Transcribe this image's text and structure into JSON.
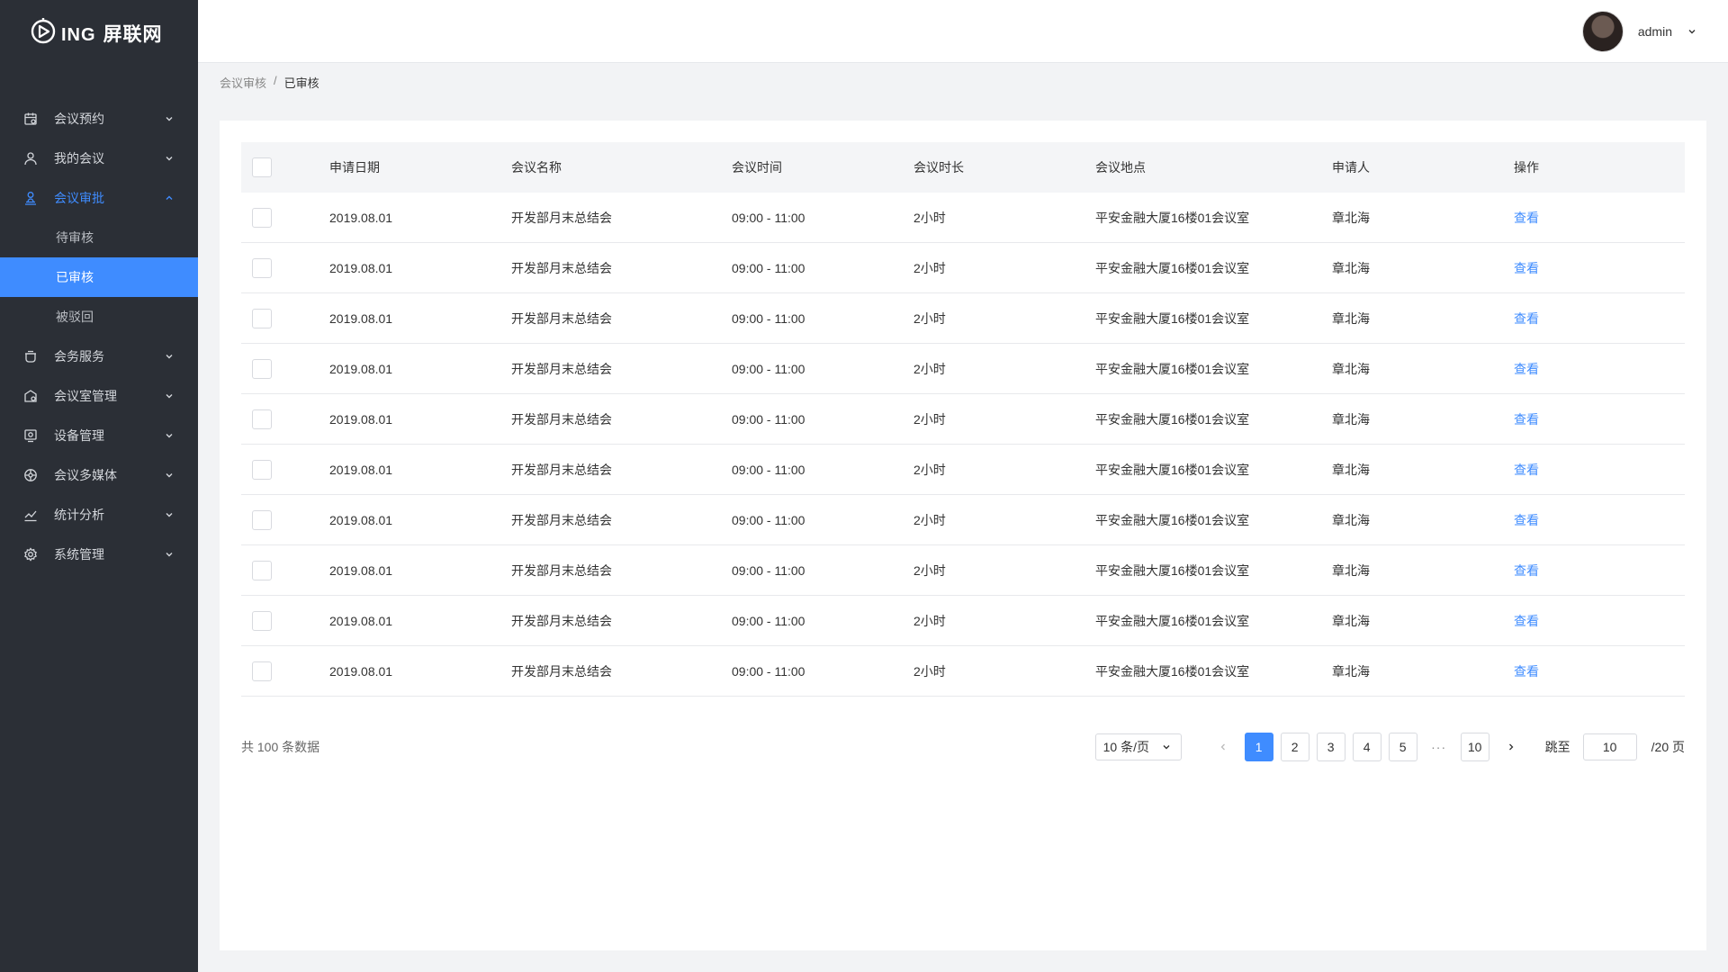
{
  "brand": {
    "ing": "ING",
    "name": "屏联网"
  },
  "header": {
    "username": "admin"
  },
  "sidebar": {
    "items": [
      {
        "label": "会议预约",
        "icon": "calendar-icon",
        "state": "collapsed"
      },
      {
        "label": "我的会议",
        "icon": "user-icon",
        "state": "collapsed"
      },
      {
        "label": "会议审批",
        "icon": "approval-icon",
        "state": "expanded",
        "children": [
          {
            "label": "待审核",
            "active": false
          },
          {
            "label": "已审核",
            "active": true
          },
          {
            "label": "被驳回",
            "active": false
          }
        ]
      },
      {
        "label": "会务服务",
        "icon": "tea-cup-icon",
        "state": "collapsed"
      },
      {
        "label": "会议室管理",
        "icon": "room-icon",
        "state": "collapsed"
      },
      {
        "label": "设备管理",
        "icon": "device-icon",
        "state": "collapsed"
      },
      {
        "label": "会议多媒体",
        "icon": "media-icon",
        "state": "collapsed"
      },
      {
        "label": "统计分析",
        "icon": "chart-icon",
        "state": "collapsed"
      },
      {
        "label": "系统管理",
        "icon": "settings-icon",
        "state": "collapsed"
      }
    ]
  },
  "breadcrumb": {
    "parent": "会议审核",
    "separator": "/",
    "current": "已审核"
  },
  "table": {
    "columns": [
      "申请日期",
      "会议名称",
      "会议时间",
      "会议时长",
      "会议地点",
      "申请人",
      "操作"
    ],
    "rows": [
      {
        "date": "2019.08.01",
        "name": "开发部月末总结会",
        "time": "09:00 - 11:00",
        "duration": "2小时",
        "location": "平安金融大厦16楼01会议室",
        "applicant": "章北海",
        "action": "查看"
      },
      {
        "date": "2019.08.01",
        "name": "开发部月末总结会",
        "time": "09:00 - 11:00",
        "duration": "2小时",
        "location": "平安金融大厦16楼01会议室",
        "applicant": "章北海",
        "action": "查看"
      },
      {
        "date": "2019.08.01",
        "name": "开发部月末总结会",
        "time": "09:00 - 11:00",
        "duration": "2小时",
        "location": "平安金融大厦16楼01会议室",
        "applicant": "章北海",
        "action": "查看"
      },
      {
        "date": "2019.08.01",
        "name": "开发部月末总结会",
        "time": "09:00 - 11:00",
        "duration": "2小时",
        "location": "平安金融大厦16楼01会议室",
        "applicant": "章北海",
        "action": "查看"
      },
      {
        "date": "2019.08.01",
        "name": "开发部月末总结会",
        "time": "09:00 - 11:00",
        "duration": "2小时",
        "location": "平安金融大厦16楼01会议室",
        "applicant": "章北海",
        "action": "查看"
      },
      {
        "date": "2019.08.01",
        "name": "开发部月末总结会",
        "time": "09:00 - 11:00",
        "duration": "2小时",
        "location": "平安金融大厦16楼01会议室",
        "applicant": "章北海",
        "action": "查看"
      },
      {
        "date": "2019.08.01",
        "name": "开发部月末总结会",
        "time": "09:00 - 11:00",
        "duration": "2小时",
        "location": "平安金融大厦16楼01会议室",
        "applicant": "章北海",
        "action": "查看"
      },
      {
        "date": "2019.08.01",
        "name": "开发部月末总结会",
        "time": "09:00 - 11:00",
        "duration": "2小时",
        "location": "平安金融大厦16楼01会议室",
        "applicant": "章北海",
        "action": "查看"
      },
      {
        "date": "2019.08.01",
        "name": "开发部月末总结会",
        "time": "09:00 - 11:00",
        "duration": "2小时",
        "location": "平安金融大厦16楼01会议室",
        "applicant": "章北海",
        "action": "查看"
      },
      {
        "date": "2019.08.01",
        "name": "开发部月末总结会",
        "time": "09:00 - 11:00",
        "duration": "2小时",
        "location": "平安金融大厦16楼01会议室",
        "applicant": "章北海",
        "action": "查看"
      }
    ]
  },
  "pagination": {
    "total_text": "共 100 条数据",
    "page_size": "10 条/页",
    "pages": [
      "1",
      "2",
      "3",
      "4",
      "5"
    ],
    "ellipsis": "···",
    "last_page": "10",
    "current_page": "1",
    "jump_label": "跳至",
    "jump_value": "10",
    "total_pages": "/20 页"
  },
  "colors": {
    "accent": "#3f8cff",
    "sidebar_bg": "#2b2f36",
    "page_bg": "#f2f3f5"
  }
}
